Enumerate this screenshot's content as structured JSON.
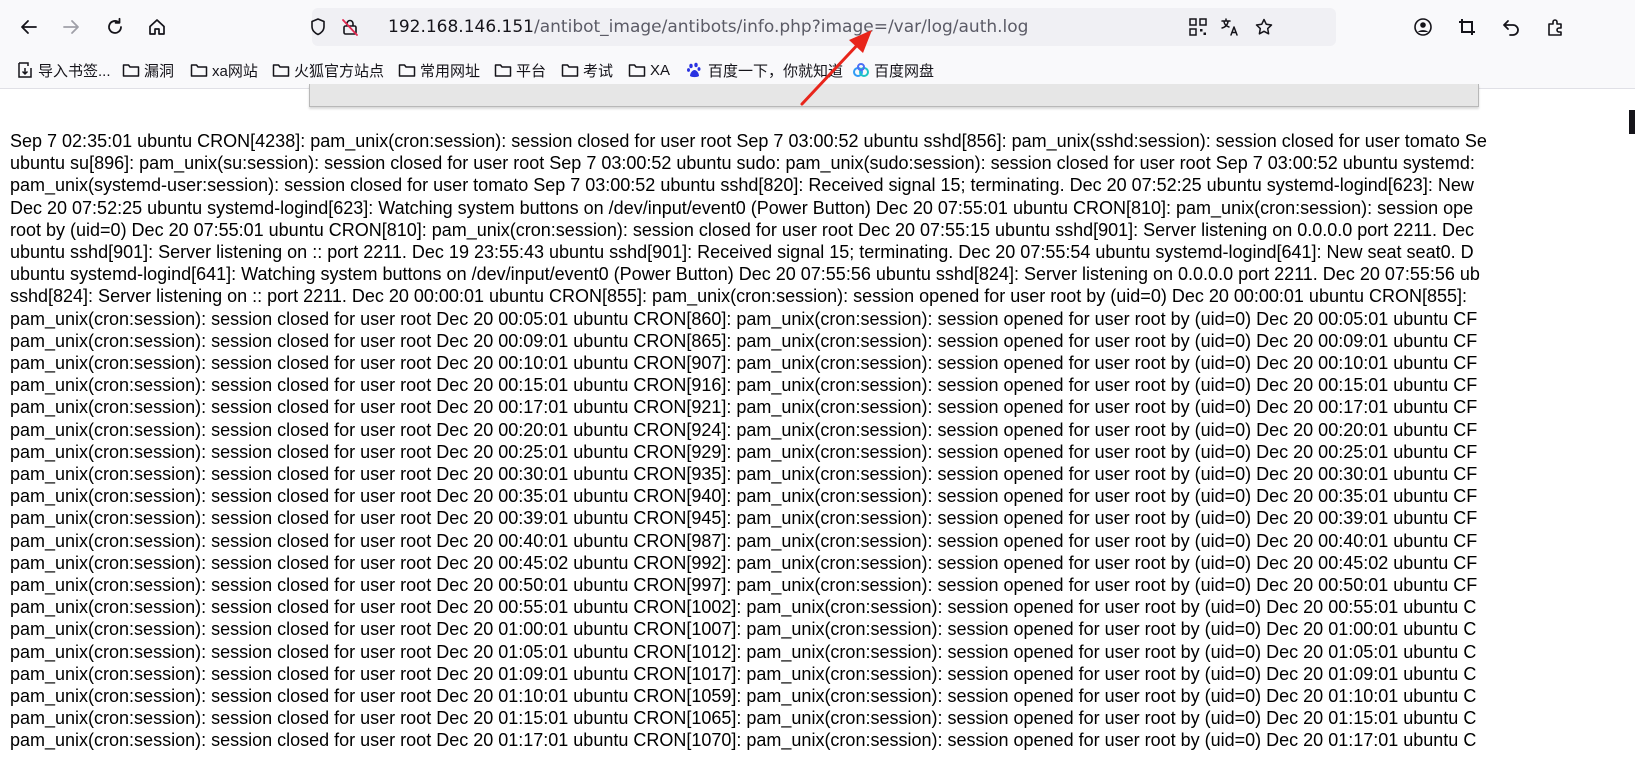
{
  "browser": {
    "url_host": "192.168.146.151",
    "url_path": "/antibot_image/antibots/info.php?image=/var/log/auth.log",
    "annotation_color": "#e8251b",
    "icons": [
      "back-icon",
      "forward-icon",
      "reload-icon",
      "home-icon",
      "shield-icon",
      "insecure-lock-icon",
      "qr-code-icon",
      "translate-icon",
      "star-icon",
      "account-icon",
      "crop-icon",
      "undo-icon",
      "extensions-icon"
    ]
  },
  "bookmarks": [
    {
      "label": "导入书签...",
      "icon": "import-icon"
    },
    {
      "label": "漏洞",
      "icon": "folder-icon"
    },
    {
      "label": "xa网站",
      "icon": "folder-icon"
    },
    {
      "label": "火狐官方站点",
      "icon": "folder-icon"
    },
    {
      "label": "常用网址",
      "icon": "folder-icon"
    },
    {
      "label": "平台",
      "icon": "folder-icon"
    },
    {
      "label": "考试",
      "icon": "folder-icon"
    },
    {
      "label": "XA",
      "icon": "folder-icon"
    },
    {
      "label": "百度一下，你就知道",
      "icon": "baidu-icon"
    },
    {
      "label": "百度网盘",
      "icon": "baidupan-icon"
    }
  ],
  "log_lines": [
    "Sep 7 02:35:01 ubuntu CRON[4238]: pam_unix(cron:session): session closed for user root Sep 7 03:00:52 ubuntu sshd[856]: pam_unix(sshd:session): session closed for user tomato Se",
    "ubuntu su[896]: pam_unix(su:session): session closed for user root Sep 7 03:00:52 ubuntu sudo: pam_unix(sudo:session): session closed for user root Sep 7 03:00:52 ubuntu systemd:",
    "pam_unix(systemd-user:session): session closed for user tomato Sep 7 03:00:52 ubuntu sshd[820]: Received signal 15; terminating. Dec 20 07:52:25 ubuntu systemd-logind[623]: New",
    "Dec 20 07:52:25 ubuntu systemd-logind[623]: Watching system buttons on /dev/input/event0 (Power Button) Dec 20 07:55:01 ubuntu CRON[810]: pam_unix(cron:session): session ope",
    "root by (uid=0) Dec 20 07:55:01 ubuntu CRON[810]: pam_unix(cron:session): session closed for user root Dec 20 07:55:15 ubuntu sshd[901]: Server listening on 0.0.0.0 port 2211. Dec",
    "ubuntu sshd[901]: Server listening on :: port 2211. Dec 19 23:55:43 ubuntu sshd[901]: Received signal 15; terminating. Dec 20 07:55:54 ubuntu systemd-logind[641]: New seat seat0. D",
    "ubuntu systemd-logind[641]: Watching system buttons on /dev/input/event0 (Power Button) Dec 20 07:55:56 ubuntu sshd[824]: Server listening on 0.0.0.0 port 2211. Dec 20 07:55:56 ub",
    "sshd[824]: Server listening on :: port 2211. Dec 20 00:00:01 ubuntu CRON[855]: pam_unix(cron:session): session opened for user root by (uid=0) Dec 20 00:00:01 ubuntu CRON[855]:",
    "pam_unix(cron:session): session closed for user root Dec 20 00:05:01 ubuntu CRON[860]: pam_unix(cron:session): session opened for user root by (uid=0) Dec 20 00:05:01 ubuntu CF",
    "pam_unix(cron:session): session closed for user root Dec 20 00:09:01 ubuntu CRON[865]: pam_unix(cron:session): session opened for user root by (uid=0) Dec 20 00:09:01 ubuntu CF",
    "pam_unix(cron:session): session closed for user root Dec 20 00:10:01 ubuntu CRON[907]: pam_unix(cron:session): session opened for user root by (uid=0) Dec 20 00:10:01 ubuntu CF",
    "pam_unix(cron:session): session closed for user root Dec 20 00:15:01 ubuntu CRON[916]: pam_unix(cron:session): session opened for user root by (uid=0) Dec 20 00:15:01 ubuntu CF",
    "pam_unix(cron:session): session closed for user root Dec 20 00:17:01 ubuntu CRON[921]: pam_unix(cron:session): session opened for user root by (uid=0) Dec 20 00:17:01 ubuntu CF",
    "pam_unix(cron:session): session closed for user root Dec 20 00:20:01 ubuntu CRON[924]: pam_unix(cron:session): session opened for user root by (uid=0) Dec 20 00:20:01 ubuntu CF",
    "pam_unix(cron:session): session closed for user root Dec 20 00:25:01 ubuntu CRON[929]: pam_unix(cron:session): session opened for user root by (uid=0) Dec 20 00:25:01 ubuntu CF",
    "pam_unix(cron:session): session closed for user root Dec 20 00:30:01 ubuntu CRON[935]: pam_unix(cron:session): session opened for user root by (uid=0) Dec 20 00:30:01 ubuntu CF",
    "pam_unix(cron:session): session closed for user root Dec 20 00:35:01 ubuntu CRON[940]: pam_unix(cron:session): session opened for user root by (uid=0) Dec 20 00:35:01 ubuntu CF",
    "pam_unix(cron:session): session closed for user root Dec 20 00:39:01 ubuntu CRON[945]: pam_unix(cron:session): session opened for user root by (uid=0) Dec 20 00:39:01 ubuntu CF",
    "pam_unix(cron:session): session closed for user root Dec 20 00:40:01 ubuntu CRON[987]: pam_unix(cron:session): session opened for user root by (uid=0) Dec 20 00:40:01 ubuntu CF",
    "pam_unix(cron:session): session closed for user root Dec 20 00:45:02 ubuntu CRON[992]: pam_unix(cron:session): session opened for user root by (uid=0) Dec 20 00:45:02 ubuntu CF",
    "pam_unix(cron:session): session closed for user root Dec 20 00:50:01 ubuntu CRON[997]: pam_unix(cron:session): session opened for user root by (uid=0) Dec 20 00:50:01 ubuntu CF",
    "pam_unix(cron:session): session closed for user root Dec 20 00:55:01 ubuntu CRON[1002]: pam_unix(cron:session): session opened for user root by (uid=0) Dec 20 00:55:01 ubuntu C",
    "pam_unix(cron:session): session closed for user root Dec 20 01:00:01 ubuntu CRON[1007]: pam_unix(cron:session): session opened for user root by (uid=0) Dec 20 01:00:01 ubuntu C",
    "pam_unix(cron:session): session closed for user root Dec 20 01:05:01 ubuntu CRON[1012]: pam_unix(cron:session): session opened for user root by (uid=0) Dec 20 01:05:01 ubuntu C",
    "pam_unix(cron:session): session closed for user root Dec 20 01:09:01 ubuntu CRON[1017]: pam_unix(cron:session): session opened for user root by (uid=0) Dec 20 01:09:01 ubuntu C",
    "pam_unix(cron:session): session closed for user root Dec 20 01:10:01 ubuntu CRON[1059]: pam_unix(cron:session): session opened for user root by (uid=0) Dec 20 01:10:01 ubuntu C",
    "pam_unix(cron:session): session closed for user root Dec 20 01:15:01 ubuntu CRON[1065]: pam_unix(cron:session): session opened for user root by (uid=0) Dec 20 01:15:01 ubuntu C",
    "pam_unix(cron:session): session closed for user root Dec 20 01:17:01 ubuntu CRON[1070]: pam_unix(cron:session): session opened for user root by (uid=0) Dec 20 01:17:01 ubuntu C"
  ]
}
